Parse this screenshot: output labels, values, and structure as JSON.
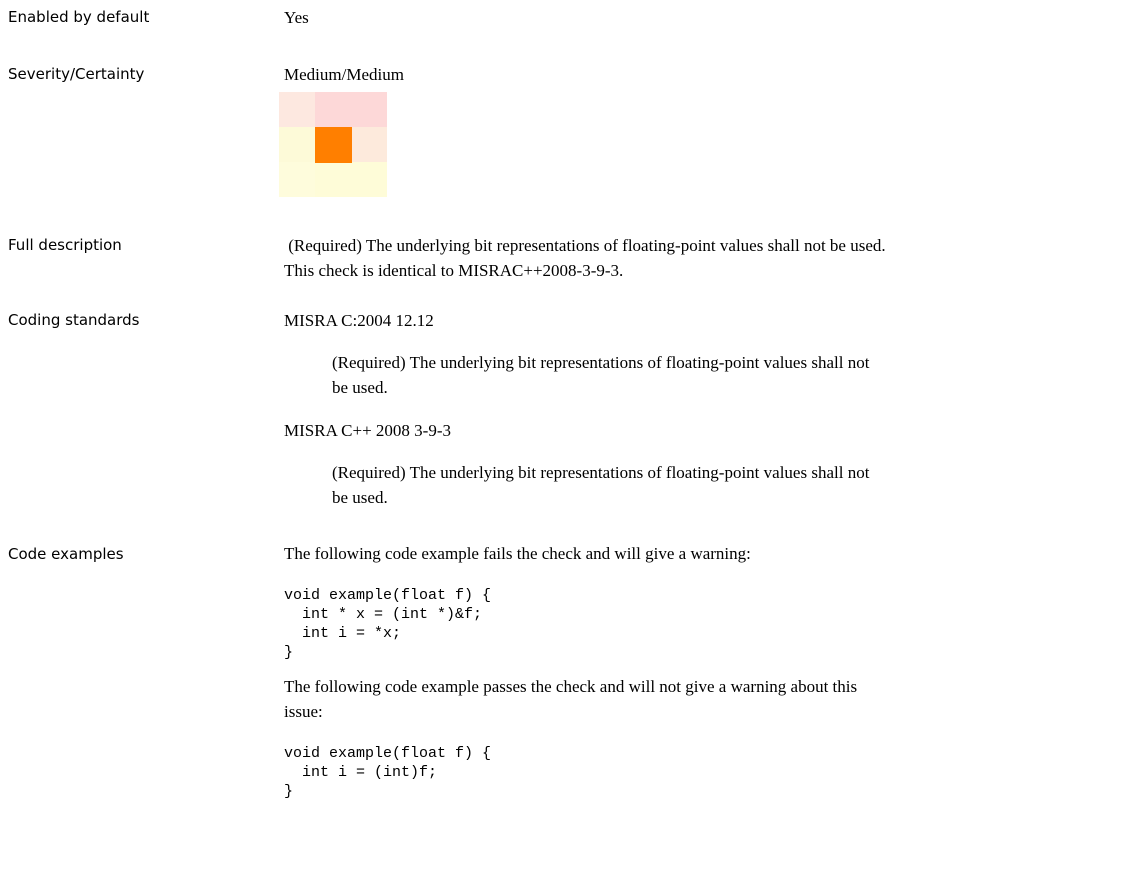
{
  "rows": {
    "enabled": {
      "label": "Enabled by default",
      "value": "Yes"
    },
    "severity": {
      "label": "Severity/Certainty",
      "value": "Medium/Medium",
      "grid": {
        "cells": [
          "#fde8e0",
          "#fdd8d8",
          "#fdd8d8",
          "#fdfad8",
          "#fef4d8",
          "#fdeadc",
          "#fefcdc",
          "#fefcd8",
          "#fefcd8"
        ],
        "marker_color": "#ff7f00",
        "marker_row": 1,
        "marker_col": 1
      }
    },
    "full_description": {
      "label": "Full description",
      "text_line1": " (Required) The underlying bit representations of floating-point values shall not be used.",
      "text_line2": "This check is identical to MISRAC++2008-3-9-3."
    },
    "coding_standards": {
      "label": "Coding standards",
      "items": [
        {
          "title": "MISRA C:2004 12.12",
          "desc_line1": "(Required) The underlying bit representations of floating-point values shall not",
          "desc_line2": "be used."
        },
        {
          "title": "MISRA C++ 2008 3-9-3",
          "desc_line1": "(Required) The underlying bit representations of floating-point values shall not",
          "desc_line2": "be used."
        }
      ]
    },
    "code_examples": {
      "label": "Code examples",
      "fail_intro": "The following code example fails the check and will give a warning:",
      "fail_code": "void example(float f) {\n  int * x = (int *)&f;\n  int i = *x;\n}",
      "pass_intro_line1": "The following code example passes the check and will not give a warning about this",
      "pass_intro_line2": "issue:",
      "pass_code": "void example(float f) {\n  int i = (int)f;\n}"
    }
  }
}
